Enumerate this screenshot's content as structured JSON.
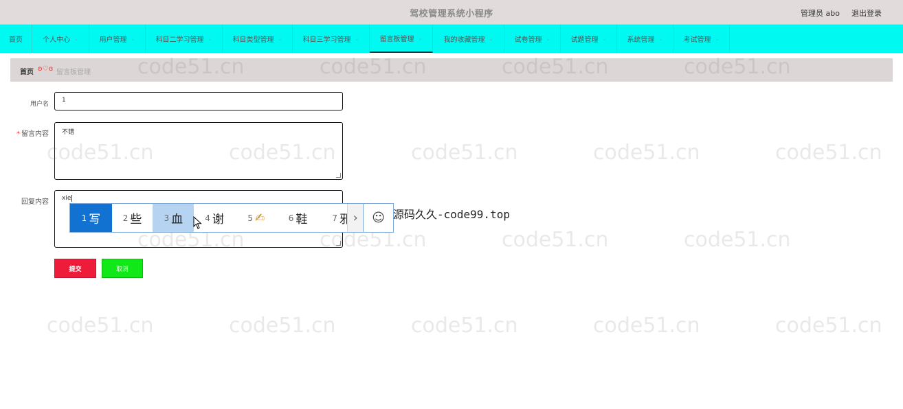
{
  "header": {
    "title": "驾校管理系统小程序",
    "user_label": "管理员 abo",
    "logout": "退出登录"
  },
  "nav": {
    "items": [
      {
        "label": "首页",
        "has_caret": false
      },
      {
        "label": "个人中心",
        "has_caret": true
      },
      {
        "label": "用户管理",
        "has_caret": true
      },
      {
        "label": "科目二学习管理",
        "has_caret": true
      },
      {
        "label": "科目类型管理",
        "has_caret": true
      },
      {
        "label": "科目三学习管理",
        "has_caret": true
      },
      {
        "label": "留言板管理",
        "has_caret": true,
        "active": true
      },
      {
        "label": "我的收藏管理",
        "has_caret": true
      },
      {
        "label": "试卷管理",
        "has_caret": true
      },
      {
        "label": "试题管理",
        "has_caret": true
      },
      {
        "label": "系统管理",
        "has_caret": true
      },
      {
        "label": "考试管理",
        "has_caret": true
      }
    ],
    "caret_glyph": "⌄"
  },
  "breadcrumb": {
    "home": "首页",
    "separator": "ʚ♡ɞ",
    "current": "留言板管理"
  },
  "form": {
    "username_label": "用户名",
    "username_value": "1",
    "content_label": "留言内容",
    "content_required": "*",
    "content_value": "不错",
    "reply_label": "回复内容",
    "reply_value": "xie",
    "submit_label": "提交",
    "cancel_label": "取消"
  },
  "ime": {
    "candidates": [
      {
        "num": "1",
        "text": "写"
      },
      {
        "num": "2",
        "text": "些"
      },
      {
        "num": "3",
        "text": "血"
      },
      {
        "num": "4",
        "text": "谢"
      },
      {
        "num": "5",
        "text": "✍"
      },
      {
        "num": "6",
        "text": "鞋"
      },
      {
        "num": "7",
        "text": "邪"
      }
    ],
    "next_glyph": "›",
    "emoji_glyph": "☺"
  },
  "overlay_text": "源码久久-code99.top",
  "watermark": "code51.cn",
  "colors": {
    "nav_bg": "#00f9f0",
    "submit_bg": "#ee1c3a",
    "cancel_bg": "#11e817",
    "ime_selected": "#1172d2"
  }
}
